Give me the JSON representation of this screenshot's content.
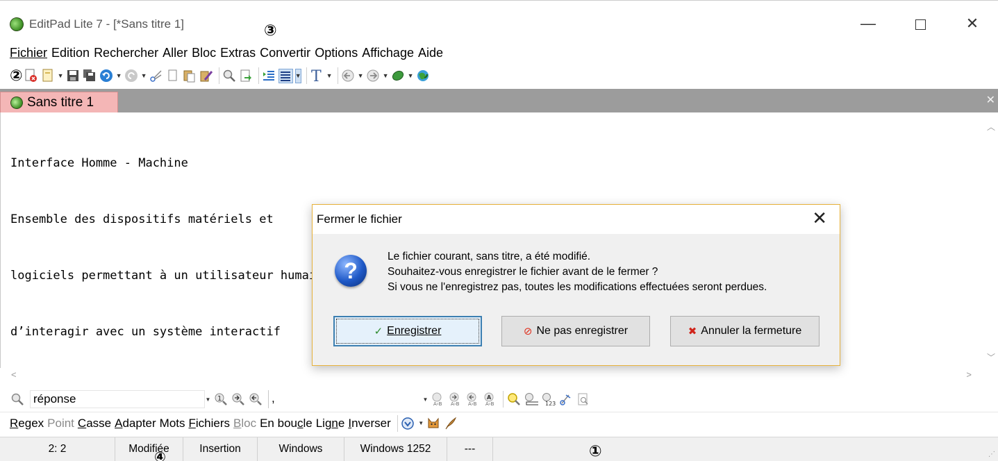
{
  "window": {
    "title": "EditPad Lite 7 - [*Sans titre 1]",
    "min_glyph": "—",
    "close_glyph": "✕"
  },
  "annotations": {
    "a1": "①",
    "a2": "②",
    "a3": "③",
    "a4": "④"
  },
  "menu": [
    "Fichier",
    "Edition",
    "Rechercher",
    "Aller",
    "Bloc",
    "Extras",
    "Convertir",
    "Options",
    "Affichage",
    "Aide"
  ],
  "tab": {
    "label": "Sans titre 1",
    "close_all": "✕"
  },
  "editor": {
    "lines": [
      "Interface Homme - Machine",
      "Ensemble des dispositifs matériels et",
      "logiciels permettant à un utilisateur humain",
      "d’interagir avec un système interactif"
    ]
  },
  "dialog": {
    "title": "Fermer le fichier",
    "icon_glyph": "?",
    "message": [
      "Le fichier courant, sans titre, a été modifié.",
      "Souhaitez-vous enregistrer le fichier avant de le fermer ?",
      "Si vous ne l'enregistrez pas, toutes les modifications effectuées seront perdues."
    ],
    "buttons": {
      "save": "Enregistrer",
      "no_save": "Ne pas enregistrer",
      "cancel": "Annuler la fermeture"
    }
  },
  "search": {
    "value": "réponse",
    "replace_value": ","
  },
  "options": [
    "Regex",
    "Point",
    "Casse",
    "Adapter",
    "Mots",
    "Fichiers",
    "Bloc",
    "En boucle",
    "Ligne",
    "Inverser"
  ],
  "status": {
    "position": "2: 2",
    "modified": "Modifiée",
    "mode": "Insertion",
    "line_break": "Windows",
    "encoding": "Windows 1252",
    "extra": "---"
  },
  "colors": {
    "tab_active": "#f4b6b6",
    "tabstrip": "#9c9c9c",
    "dialog_border": "#e6b13a",
    "primary_button": "#e5f1fb"
  }
}
